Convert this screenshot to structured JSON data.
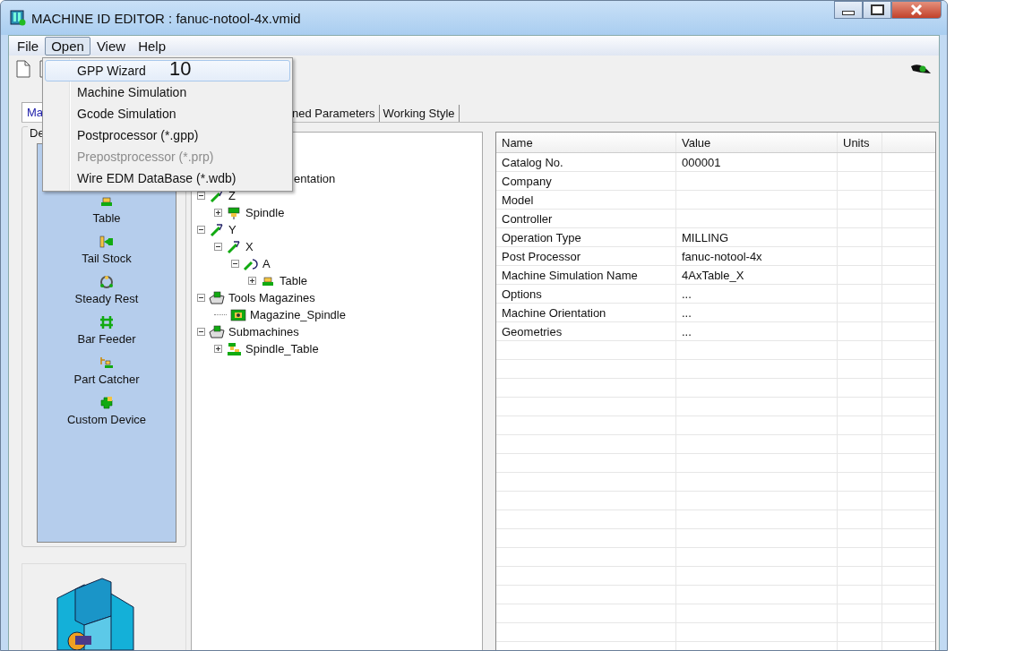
{
  "window": {
    "title": "MACHINE ID EDITOR : fanuc-notool-4x.vmid"
  },
  "menu_bar": [
    {
      "label": "File",
      "selected": false
    },
    {
      "label": "Open",
      "selected": true
    },
    {
      "label": "View",
      "selected": false
    },
    {
      "label": "Help",
      "selected": false
    }
  ],
  "open_menu": {
    "annotation": "10",
    "items": [
      {
        "label": "GPP Wizard",
        "selected": true,
        "disabled": false
      },
      {
        "label": "Machine Simulation",
        "selected": false,
        "disabled": false
      },
      {
        "label": "Gcode Simulation",
        "selected": false,
        "disabled": false
      },
      {
        "label": "Postprocessor (*.gpp)",
        "selected": false,
        "disabled": false
      },
      {
        "label": "Prepostprocessor (*.prp)",
        "selected": false,
        "disabled": true
      },
      {
        "label": "Wire EDM DataBase (*.wdb)",
        "selected": false,
        "disabled": false
      }
    ]
  },
  "tabs": [
    {
      "label": "Ma",
      "selected": true
    },
    {
      "label": "ned Parameters",
      "selected": false
    },
    {
      "label": "Working Style",
      "selected": false
    }
  ],
  "devices_group": {
    "label": "De",
    "items": [
      {
        "label": "Table",
        "kind": "table"
      },
      {
        "label": "Tail Stock",
        "kind": "tailstock"
      },
      {
        "label": "Steady Rest",
        "kind": "steadyrest"
      },
      {
        "label": "Bar Feeder",
        "kind": "barfeeder"
      },
      {
        "label": "Part Catcher",
        "kind": "partcatcher"
      },
      {
        "label": "Custom Device",
        "kind": "custom"
      }
    ]
  },
  "tree": {
    "clipped_item": "entation",
    "items": [
      {
        "label": "Z",
        "kind": "axis",
        "expanded": true,
        "children": [
          {
            "label": "Spindle",
            "kind": "spindle",
            "expanded": false
          }
        ]
      },
      {
        "label": "Y",
        "kind": "axis",
        "expanded": true,
        "children": [
          {
            "label": "X",
            "kind": "axis",
            "expanded": true,
            "children": [
              {
                "label": "A",
                "kind": "rotary",
                "expanded": true,
                "children": [
                  {
                    "label": "Table",
                    "kind": "table",
                    "expanded": false
                  }
                ]
              }
            ]
          }
        ]
      },
      {
        "label": "Tools Magazines",
        "kind": "magazines",
        "expanded": true,
        "children": [
          {
            "label": "Magazine_Spindle",
            "kind": "magazine"
          }
        ]
      },
      {
        "label": "Submachines",
        "kind": "submachines",
        "expanded": true,
        "children": [
          {
            "label": "Spindle_Table",
            "kind": "submachine",
            "expanded": false
          }
        ]
      }
    ]
  },
  "properties": {
    "columns": [
      "Name",
      "Value",
      "Units"
    ],
    "rows": [
      {
        "name": "Catalog No.",
        "value": "000001"
      },
      {
        "name": "Company"
      },
      {
        "name": "Model"
      },
      {
        "name": "Controller"
      },
      {
        "name": "Operation Type",
        "value": "MILLING"
      },
      {
        "name": "Post Processor",
        "value": "fanuc-notool-4x"
      },
      {
        "name": "Machine Simulation Name",
        "value": "4AxTable_X"
      },
      {
        "name": "Options",
        "value": "..."
      },
      {
        "name": "Machine Orientation",
        "value": "..."
      },
      {
        "name": "Geometries",
        "value": "..."
      }
    ]
  }
}
